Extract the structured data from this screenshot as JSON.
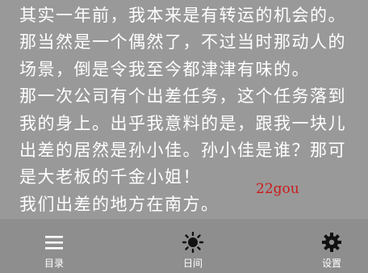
{
  "reader": {
    "lines": [
      "其实一年前，我本来是有转运的机会的。",
      "那当然是一个偶然了，不过当时那动人的",
      "场景，倒是令我至今都津津有味的。",
      "那一次公司有个出差任务，这个任务落到",
      "我的身上。出乎我意料的是，跟我一块儿",
      "出差的居然是孙小佳。孙小佳是谁？那可",
      "是大老板的千金小姐！",
      "我们出差的地方在南方。"
    ],
    "watermark": "22gou",
    "watermark_color": "#cc1b1b",
    "background": "#999999",
    "text_color": "#ffffff"
  },
  "toolbar": {
    "background": "#8e8e8e",
    "items": [
      {
        "label": "目录",
        "icon": "menu-icon"
      },
      {
        "label": "日间",
        "icon": "sun-icon"
      },
      {
        "label": "设置",
        "icon": "gear-icon"
      }
    ]
  }
}
